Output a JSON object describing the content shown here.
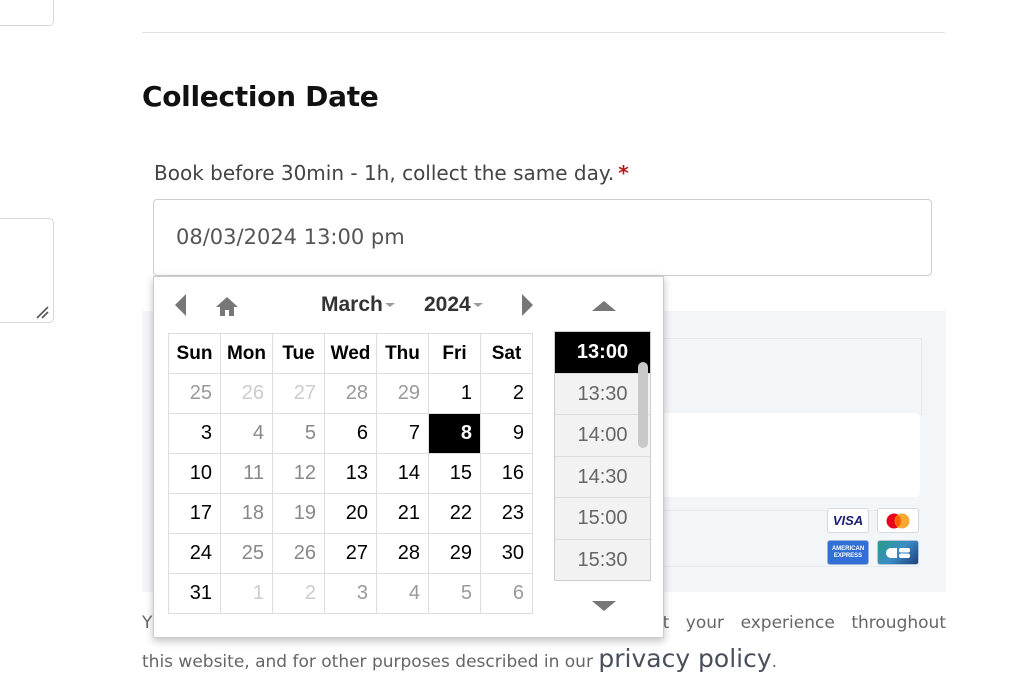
{
  "section": {
    "title": "Collection Date",
    "field_label": "Book before 30min - 1h, collect the same day.",
    "required_mark": "*",
    "date_value": "08/03/2024 13:00 pm"
  },
  "datepicker": {
    "month": "March",
    "year": "2024",
    "weekdays": [
      "Sun",
      "Mon",
      "Tue",
      "Wed",
      "Thu",
      "Fri",
      "Sat"
    ],
    "weeks": [
      [
        {
          "d": "25",
          "s": "other"
        },
        {
          "d": "26",
          "s": "faded"
        },
        {
          "d": "27",
          "s": "faded"
        },
        {
          "d": "28",
          "s": "other"
        },
        {
          "d": "29",
          "s": "other"
        },
        {
          "d": "1",
          "s": ""
        },
        {
          "d": "2",
          "s": ""
        }
      ],
      [
        {
          "d": "3",
          "s": ""
        },
        {
          "d": "4",
          "s": "disabled"
        },
        {
          "d": "5",
          "s": "disabled"
        },
        {
          "d": "6",
          "s": ""
        },
        {
          "d": "7",
          "s": ""
        },
        {
          "d": "8",
          "s": "selected"
        },
        {
          "d": "9",
          "s": ""
        }
      ],
      [
        {
          "d": "10",
          "s": ""
        },
        {
          "d": "11",
          "s": "disabled"
        },
        {
          "d": "12",
          "s": "disabled"
        },
        {
          "d": "13",
          "s": ""
        },
        {
          "d": "14",
          "s": ""
        },
        {
          "d": "15",
          "s": ""
        },
        {
          "d": "16",
          "s": ""
        }
      ],
      [
        {
          "d": "17",
          "s": ""
        },
        {
          "d": "18",
          "s": "disabled"
        },
        {
          "d": "19",
          "s": "disabled"
        },
        {
          "d": "20",
          "s": ""
        },
        {
          "d": "21",
          "s": ""
        },
        {
          "d": "22",
          "s": ""
        },
        {
          "d": "23",
          "s": ""
        }
      ],
      [
        {
          "d": "24",
          "s": ""
        },
        {
          "d": "25",
          "s": "disabled"
        },
        {
          "d": "26",
          "s": "disabled"
        },
        {
          "d": "27",
          "s": ""
        },
        {
          "d": "28",
          "s": ""
        },
        {
          "d": "29",
          "s": ""
        },
        {
          "d": "30",
          "s": ""
        }
      ],
      [
        {
          "d": "31",
          "s": ""
        },
        {
          "d": "1",
          "s": "faded"
        },
        {
          "d": "2",
          "s": "faded"
        },
        {
          "d": "3",
          "s": "other"
        },
        {
          "d": "4",
          "s": "other"
        },
        {
          "d": "5",
          "s": "other"
        },
        {
          "d": "6",
          "s": "other"
        }
      ]
    ],
    "selected_day": "8",
    "times": [
      "13:00",
      "13:30",
      "14:00",
      "14:30",
      "15:00",
      "15:30"
    ],
    "selected_time": "13:00"
  },
  "payment": {
    "cards": {
      "visa": "VISA",
      "amex_line1": "AMERICAN",
      "amex_line2": "EXPRESS"
    }
  },
  "consent": {
    "prefix": "Y",
    "visible_tail": "port your experience throughout this website, and for other purposes described in our",
    "link": "privacy policy",
    "suffix": "."
  }
}
